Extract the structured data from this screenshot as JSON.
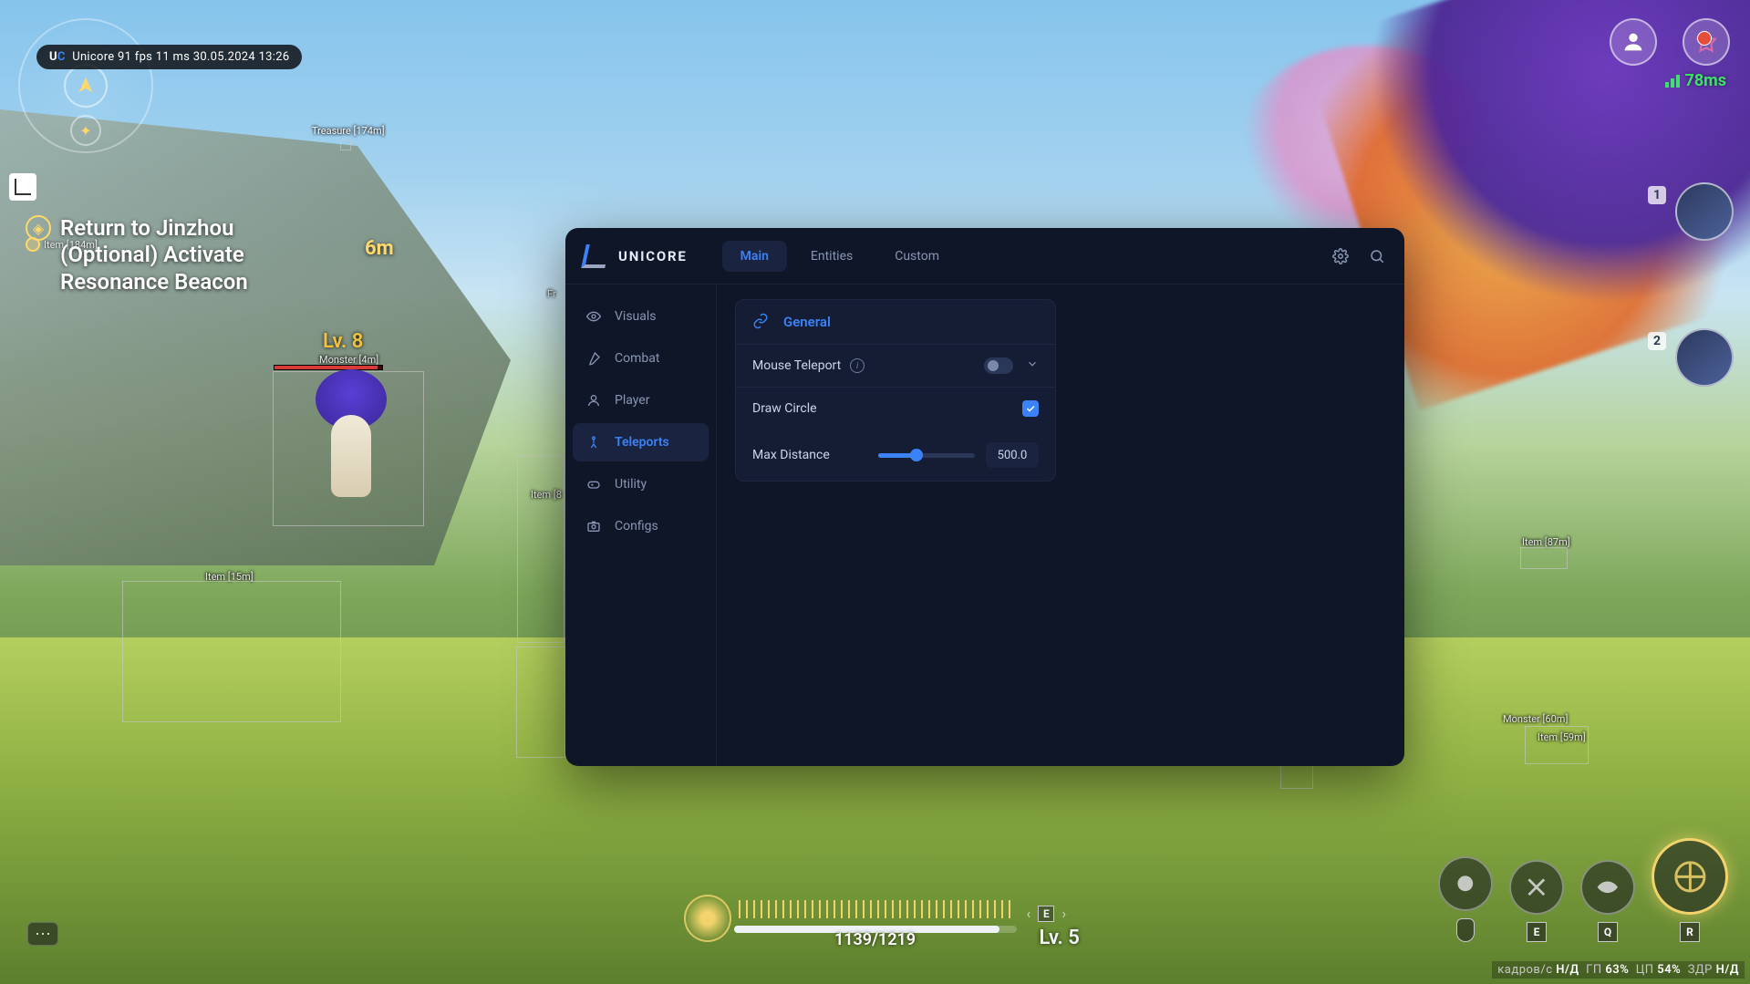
{
  "overlay": {
    "brand_u": "U",
    "brand_c": "C",
    "brand_name": "Unicore",
    "fps": "91 fps",
    "frametime": "11 ms",
    "date": "30.05.2024",
    "time": "13:26"
  },
  "top_right": {
    "ping": "78ms"
  },
  "party": {
    "slots": [
      "1",
      "2"
    ]
  },
  "quest": {
    "item_label": "Item [184m]",
    "lines": [
      "Return to Jinzhou",
      "(Optional) Activate",
      "Resonance Beacon"
    ],
    "distance": "6m"
  },
  "esp": {
    "treasure": "Treasure [174m]",
    "monster_close": "Monster [4m]",
    "monster_far": "Monster [60m]",
    "item_15": "Item [15m]",
    "item_8": "Item [8",
    "item_87": "Item [87m]",
    "item_59": "Item [59m]",
    "fr": "Fr"
  },
  "enemy": {
    "level": "Lv. 8",
    "hp_pct": 96
  },
  "bottom": {
    "stamina": "1139/1219",
    "stamina_pct": 94,
    "level": "Lv. 5",
    "compass_point": "E",
    "skills_keys": [
      "",
      "E",
      "Q",
      "R"
    ]
  },
  "perf": {
    "fps_k": "кадров/с",
    "fps_v": "Н/Д",
    "gpu_k": "ГП",
    "gpu_v": "63%",
    "cpu_k": "ЦП",
    "cpu_v": "54%",
    "hp_k": "ЗДР",
    "hp_v": "Н/Д"
  },
  "panel": {
    "brand": "UNICORE",
    "tabs": [
      "Main",
      "Entities",
      "Custom"
    ],
    "active_tab": 0,
    "sidebar": [
      "Visuals",
      "Combat",
      "Player",
      "Teleports",
      "Utility",
      "Configs"
    ],
    "active_side": 3,
    "section_title": "General",
    "mouse_teleport": {
      "label": "Mouse Teleport",
      "enabled": false
    },
    "draw_circle": {
      "label": "Draw Circle",
      "value": true
    },
    "max_distance": {
      "label": "Max Distance",
      "value": "500.0",
      "pct": 40
    }
  }
}
